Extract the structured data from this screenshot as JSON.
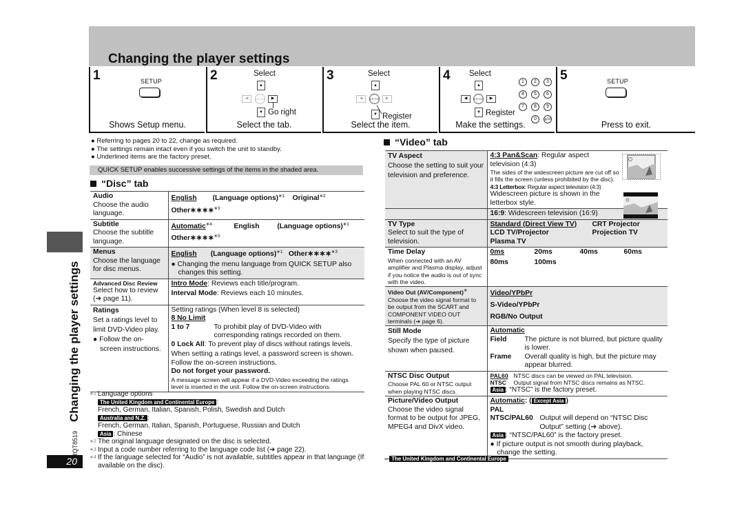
{
  "page": {
    "title": "Changing the player settings",
    "side_title": "Changing the player settings",
    "doc_code": "RQT8519",
    "page_number": "20"
  },
  "steps": [
    {
      "number": "1",
      "button": "SETUP",
      "caption": "Shows Setup menu."
    },
    {
      "number": "2",
      "select": "Select",
      "go": "Go right",
      "caption": "Select the tab."
    },
    {
      "number": "3",
      "select": "Select",
      "register": "Register",
      "caption": "Select the item."
    },
    {
      "number": "4",
      "select": "Select",
      "register": "Register",
      "keys": [
        "1",
        "2",
        "3",
        "4",
        "5",
        "6",
        "7",
        "8",
        "9",
        "0",
        "≧10"
      ],
      "caption": "Make the settings."
    },
    {
      "number": "5",
      "button": "SETUP",
      "caption": "Press to exit."
    }
  ],
  "remote": {
    "enter": "ENTER",
    "up": "▲",
    "down": "▼",
    "left": "◀",
    "right": "▶"
  },
  "intro": {
    "bullets": [
      "Referring to pages 20 to 22, change as required.",
      "The settings remain intact even if you switch the unit to standby.",
      "Underlined items are the factory preset."
    ],
    "quick_setup": "QUICK SETUP enables successive settings of the items in the shaded area."
  },
  "disc_tab": {
    "heading": "“Disc” tab",
    "rows": [
      {
        "name": "Audio",
        "desc": "Choose the audio language.",
        "opt1": "English",
        "opt2": "(Language options)",
        "opt2_mark": "∗1",
        "opt3": "Original",
        "opt3_mark": "∗2",
        "opt4": "Other∗∗∗∗",
        "opt4_mark": "∗3"
      },
      {
        "name": "Subtitle",
        "desc": "Choose the subtitle language.",
        "opt1": "Automatic",
        "opt1_mark": "∗4",
        "opt2": "English",
        "opt3": "(Language options)",
        "opt3_mark": "∗1",
        "opt4": "Other∗∗∗∗",
        "opt4_mark": "∗3"
      },
      {
        "name": "Menus",
        "desc": "Choose the language for disc menus.",
        "opt1": "English",
        "opt2": "(Language options)",
        "opt2_mark": "∗1",
        "opt3": "Other∗∗∗∗",
        "opt3_mark": "∗3",
        "note": "Changing the menu language from QUICK SETUP also changes this setting."
      },
      {
        "name": "Advanced Disc Review",
        "desc": "Select how to review (➔ page 11).",
        "opt1": "Intro Mode",
        "opt1_text": ": Reviews each title/program.",
        "opt2": "Interval Mode",
        "opt2_text": ": Reviews each 10 minutes."
      },
      {
        "name": "Ratings",
        "desc": "Set a ratings level to limit DVD-Video play.",
        "bullet": "Follow the on-screen instructions.",
        "line1": "Setting ratings (When level 8 is selected)",
        "opt1": "8 No Limit",
        "opt2": "1 to 7",
        "opt2_text": "To prohibit play of DVD-Video with corresponding ratings recorded on them.",
        "opt3": "0 Lock All",
        "opt3_text": ": To prevent play of discs without ratings levels.",
        "line2": "When setting a ratings level, a password screen is shown. Follow the on-screen instructions.",
        "warn": "Do not forget your password.",
        "line3": "A message screen will appear if a DVD-Video exceeding the ratings level is inserted in the unit. Follow the on-screen instructions."
      }
    ]
  },
  "footnotes": {
    "f1_mark": "∗1",
    "f1_title": "Language options",
    "f1_region1": "The United Kingdom and Continental Europe",
    "f1_langs1": "French, German, Italian, Spanish, Polish, Swedish and Dutch",
    "f1_region2": "Australia and N.Z.",
    "f1_langs2": "French, German, Italian, Spanish, Portuguese, Russian and Dutch",
    "f1_region3": "Asia",
    "f1_langs3": ": Chinese",
    "f2_mark": "∗2",
    "f2": "The original language designated on the disc is selected.",
    "f3_mark": "∗3",
    "f3": "Input a code number referring to the language code list (➔ page 22).",
    "f4_mark": "∗4",
    "f4": "If the language selected for “Audio” is not available, subtitles appear in that language (If available on the disc)."
  },
  "video_tab": {
    "heading": "“Video” tab",
    "rows": [
      {
        "name": "TV Aspect",
        "desc": "Choose the setting to suit your television and preference.",
        "opt1": "4:3 Pan&Scan",
        "opt1_text": ": Regular aspect television (4:3)",
        "opt1_note": "The sides of the widescreen picture are cut off so it fills the screen (unless prohibited by the disc).",
        "opt2": "4:3 Letterbox",
        "opt2_text": ": Regular aspect television (4:3)",
        "opt2_note": "Widescreen picture is shown in the letterbox style.",
        "opt3": "16:9",
        "opt3_text": ": Widescreen television (16:9)"
      },
      {
        "name": "TV Type",
        "desc": "Select to suit the type of television.",
        "opts": [
          "Standard (Direct View TV)",
          "CRT Projector",
          "LCD TV/Projector",
          "Projection TV",
          "Plasma TV"
        ]
      },
      {
        "name": "Time Delay",
        "desc": "When connected with an AV amplifier and Plasma display, adjust if you notice the audio is out of sync with the video.",
        "opts": [
          "0ms",
          "20ms",
          "40ms",
          "60ms",
          "80ms",
          "100ms"
        ]
      },
      {
        "name": "Video Out (AV/Component)",
        "name_mark": "∗",
        "desc": "Choose the video signal format to be output from the SCART and COMPONENT VIDEO OUT terminals (➔ page 6).",
        "opts": [
          "Video/YPbPr",
          "S-Video/YPbPr",
          "RGB/No Output"
        ]
      },
      {
        "name": "Still Mode",
        "desc": "Specify the type of picture shown when paused.",
        "opt1": "Automatic",
        "opt2": "Field",
        "opt2_text": "The picture is not blurred, but picture quality is lower.",
        "opt3": "Frame",
        "opt3_text": "Overall quality is high, but the picture may appear blurred."
      },
      {
        "name": "NTSC Disc Output",
        "desc": "Choose PAL 60 or NTSC output when playing NTSC discs.",
        "opt1": "PAL60",
        "opt1_text": "NTSC discs can be viewed on PAL television.",
        "opt2": "NTSC",
        "opt2_text": "Output signal from NTSC discs remains as NTSC.",
        "asia_tag": "Asia",
        "asia_text": ": “NTSC” is the factory preset."
      },
      {
        "name": "Picture/Video Output",
        "desc": "Choose the video signal format to be output for JPEG, MPEG4 and DivX video.",
        "opt1": "Automatic",
        "except_tag": "Except Asia",
        "opt2": "PAL",
        "opt3": "NTSC/PAL60",
        "opt3_text": "Output will depend on “NTSC Disc Output” setting (➔ above).",
        "asia_tag": "Asia",
        "asia_text": ": “NTSC/PAL60” is the factory preset.",
        "note": "If picture output is not smooth during playback, change the setting."
      }
    ],
    "footnote_mark": "∗",
    "footnote_tag": "The United Kingdom and Continental Europe"
  }
}
